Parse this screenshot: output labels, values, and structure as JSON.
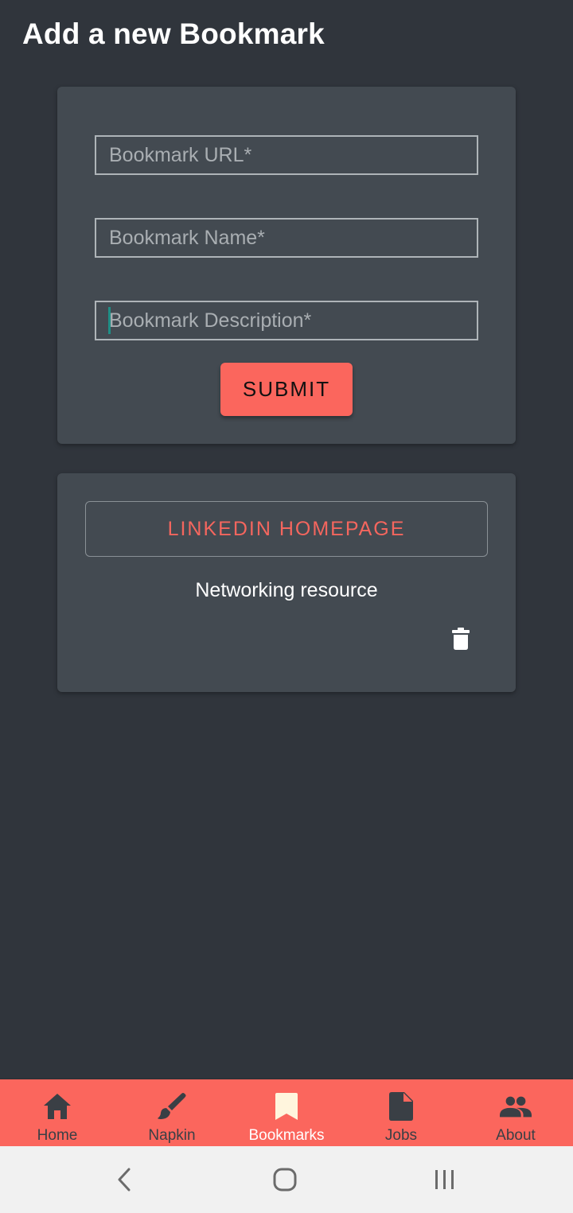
{
  "header": {
    "title": "Add a new Bookmark"
  },
  "form": {
    "url_placeholder": "Bookmark URL*",
    "name_placeholder": "Bookmark Name*",
    "description_placeholder": "Bookmark Description*",
    "submit_label": "SUBMIT"
  },
  "bookmarks": [
    {
      "name": "LINKEDIN HOMEPAGE",
      "description": "Networking resource",
      "delete_icon": "trash-icon"
    }
  ],
  "nav": {
    "active": "Bookmarks",
    "items": [
      {
        "label": "Home",
        "icon": "home-icon"
      },
      {
        "label": "Napkin",
        "icon": "brush-icon"
      },
      {
        "label": "Bookmarks",
        "icon": "bookmark-icon"
      },
      {
        "label": "Jobs",
        "icon": "document-icon"
      },
      {
        "label": "About",
        "icon": "people-icon"
      }
    ]
  },
  "system_nav": {
    "icons": [
      "back-icon",
      "home-circle-icon",
      "recents-icon"
    ]
  },
  "colors": {
    "background": "#30353c",
    "card": "#434a51",
    "accent": "#fb665d",
    "nav_inactive": "#3a3f45",
    "caret": "#1f8f86"
  }
}
